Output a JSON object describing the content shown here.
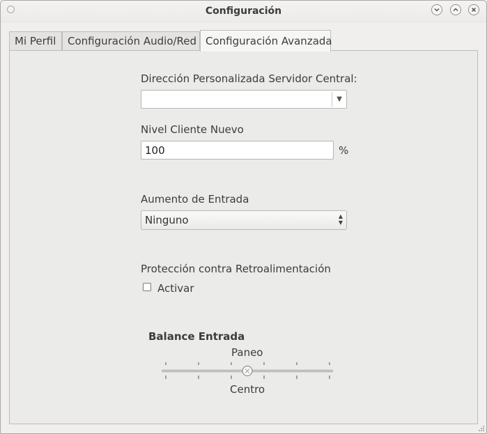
{
  "window": {
    "title": "Configuración",
    "controls": [
      "minimize",
      "maximize",
      "close"
    ]
  },
  "tabs": [
    {
      "label": "Mi Perfil",
      "active": false
    },
    {
      "label": "Configuración Audio/Red",
      "active": false
    },
    {
      "label": "Configuración Avanzada",
      "active": true
    }
  ],
  "advanced": {
    "central_server": {
      "label": "Dirección Personalizada Servidor Central:",
      "value": ""
    },
    "new_client_level": {
      "label": "Nivel Cliente Nuevo",
      "value": "100",
      "unit": "%"
    },
    "input_boost": {
      "label": "Aumento de Entrada",
      "selected": "Ninguno"
    },
    "feedback_protection": {
      "label": "Protección contra Retroalimentación",
      "checkbox_label": "Activar",
      "checked": false
    },
    "input_balance": {
      "title": "Balance Entrada",
      "pan_label": "Paneo",
      "center_label": "Centro",
      "value": 0
    }
  }
}
